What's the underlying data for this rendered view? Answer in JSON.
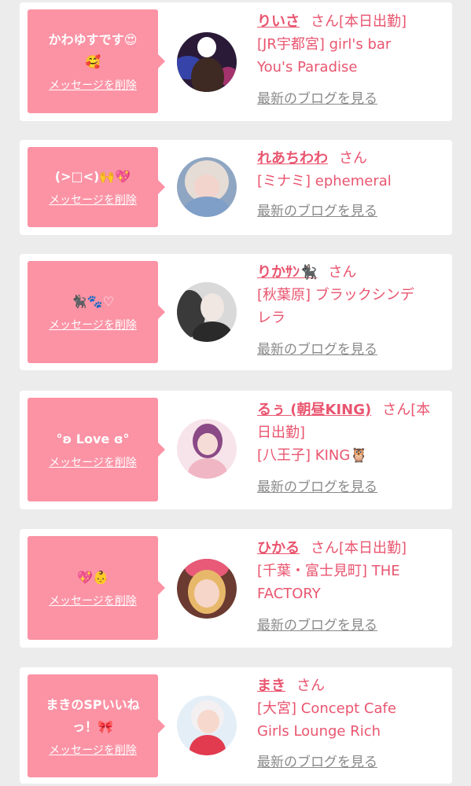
{
  "colors": {
    "accent": "#e9556f",
    "bubble": "#fb93a5",
    "background": "#ececec"
  },
  "delete_label": "メッセージを削除",
  "blog_label": "最新のブログを見る",
  "items": [
    {
      "message_lines": [
        "かわゆすです😍",
        "🥰"
      ],
      "name": "りいさ",
      "suffix": "さん[本日出勤]",
      "suffix_line2": "",
      "shop_lines": [
        "[JR宇都宮] girl's bar",
        "You's Paradise"
      ]
    },
    {
      "message_lines": [
        "(>□<)🙌💖"
      ],
      "name": "れあちわわ",
      "suffix": "さん",
      "suffix_line2": "",
      "shop_lines": [
        "[ミナミ] ephemeral"
      ]
    },
    {
      "message_lines": [
        "🐈‍⬛🐾♡"
      ],
      "name": "りかｻﾝ🐈‍⬛",
      "suffix": "さん",
      "suffix_line2": "",
      "shop_lines": [
        "[秋葉原] ブラックシンデ",
        "レラ"
      ]
    },
    {
      "message_lines": [
        "°ʚ Love ɞ°"
      ],
      "name": "るぅ (朝昼KING)",
      "suffix": "さん[本",
      "suffix_line2": "日出勤]",
      "shop_lines": [
        "[八王子] KING🦉"
      ]
    },
    {
      "message_lines": [
        "💖👶"
      ],
      "name": "ひかる",
      "suffix": "さん[本日出勤]",
      "suffix_line2": "",
      "shop_lines": [
        "[千葉・富士見町] THE",
        "FACTORY"
      ]
    },
    {
      "message_lines": [
        "まきのSPいいね",
        "っ！🎀"
      ],
      "name": "まき",
      "suffix": "さん",
      "suffix_line2": "",
      "shop_lines": [
        "[大宮] Concept Cafe",
        "Girls Lounge Rich"
      ]
    }
  ]
}
